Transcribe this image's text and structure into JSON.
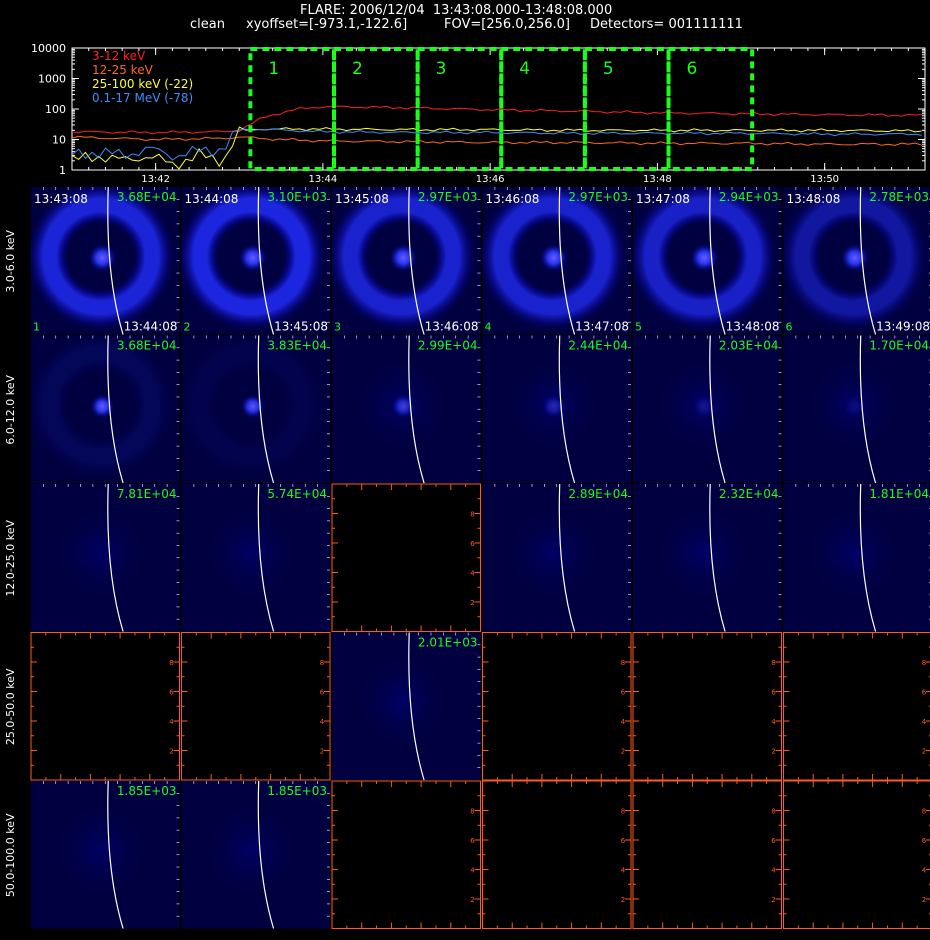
{
  "header": {
    "title": "FLARE: 2006/12/04  13:43:08.000-13:48:08.000",
    "mode": "clean",
    "xyoffset": "xyoffset=[-973.1,-122.6]",
    "fov": "FOV=[256.0,256.0]",
    "detectors": "Detectors= 001111111"
  },
  "colors": {
    "red": "#ff2020",
    "orange": "#ff6a1a",
    "yellow": "#ffff30",
    "blue": "#3f8cff",
    "green": "#19ff19",
    "empty_axis": "#ff5a1e",
    "image_bg": "#000040"
  },
  "chart_data": [
    {
      "type": "line",
      "title": "",
      "y_scale": "log",
      "ylim": [
        1,
        10000
      ],
      "y_ticks": [
        "1",
        "10",
        "100",
        "1000",
        "10000"
      ],
      "x_ticks": [
        "13:42",
        "13:44",
        "13:46",
        "13:48",
        "13:50"
      ],
      "xlim_minutes": [
        41.0,
        51.2
      ],
      "legend_placement": "top-left",
      "series": [
        {
          "name": "3-12 keV",
          "color": "#ff2020",
          "x": [
            41.0,
            42.0,
            42.8,
            43.0,
            43.3,
            43.7,
            44.0,
            45.0,
            46.0,
            47.0,
            48.0,
            49.0,
            50.0,
            51.2
          ],
          "y": [
            18,
            17,
            18,
            20,
            55,
            100,
            120,
            110,
            95,
            85,
            75,
            70,
            65,
            62
          ]
        },
        {
          "name": "12-25 keV",
          "color": "#ff6a1a",
          "x": [
            41.0,
            42.0,
            42.8,
            43.0,
            43.5,
            44.0,
            45.0,
            46.0,
            47.0,
            48.0,
            49.0,
            50.0,
            51.2
          ],
          "y": [
            12,
            10,
            11,
            12,
            10,
            9,
            8.5,
            8,
            8,
            7.5,
            7.5,
            7,
            7
          ]
        },
        {
          "name": "25-100 keV (-22)",
          "color": "#ffff30",
          "x": [
            41.0,
            41.3,
            41.6,
            41.9,
            42.2,
            42.5,
            42.8,
            43.0,
            43.2,
            44.0,
            45.0,
            46.0,
            47.0,
            48.0,
            49.0,
            50.0,
            51.2
          ],
          "y": [
            2,
            3,
            2,
            3,
            1.5,
            3,
            2,
            18,
            22,
            22,
            21,
            21,
            20,
            20,
            20,
            20,
            19
          ]
        },
        {
          "name": "0.1-17 MeV (-78)",
          "color": "#3f8cff",
          "x": [
            41.0,
            41.3,
            41.6,
            41.9,
            42.2,
            42.5,
            42.8,
            43.0,
            43.2,
            44.0,
            45.0,
            46.0,
            47.0,
            48.0,
            49.0,
            50.0,
            51.2
          ],
          "y": [
            3,
            4,
            3,
            5,
            3,
            4,
            5,
            20,
            22,
            18,
            17,
            17,
            16,
            16,
            16,
            15,
            15
          ]
        }
      ],
      "intervals": [
        {
          "label": "1",
          "start": 43.133,
          "end": 44.133
        },
        {
          "label": "2",
          "start": 44.133,
          "end": 45.133
        },
        {
          "label": "3",
          "start": 45.133,
          "end": 46.133
        },
        {
          "label": "4",
          "start": 46.133,
          "end": 47.133
        },
        {
          "label": "5",
          "start": 47.133,
          "end": 48.133
        },
        {
          "label": "6",
          "start": 48.133,
          "end": 49.133
        }
      ]
    },
    {
      "type": "heatmap",
      "columns": [
        {
          "start": "13:43:08",
          "end": "13:44:08",
          "index": "1"
        },
        {
          "start": "13:44:08",
          "end": "13:45:08",
          "index": "2"
        },
        {
          "start": "13:45:08",
          "end": "13:46:08",
          "index": "3"
        },
        {
          "start": "13:46:08",
          "end": "13:47:08",
          "index": "4"
        },
        {
          "start": "13:47:08",
          "end": "13:48:08",
          "index": "5"
        },
        {
          "start": "13:48:08",
          "end": "13:49:08",
          "index": "6"
        }
      ],
      "empty_tick_labels": [
        "2",
        "4",
        "6",
        "8"
      ],
      "rows": [
        {
          "label": "3.0-6.0 keV",
          "show_times": true,
          "peaks": [
            "3.68E+04",
            "3.10E+03",
            "2.97E+03",
            "2.97E+03",
            "2.94E+03",
            "2.78E+03"
          ],
          "ring": [
            0.95,
            1.0,
            0.9,
            0.9,
            0.85,
            0.6
          ]
        },
        {
          "label": "6.0-12.0 keV",
          "show_times": false,
          "peaks": [
            "3.68E+04",
            "3.83E+04",
            "2.99E+04",
            "2.44E+04",
            "2.03E+04",
            "1.70E+04"
          ],
          "ring": [
            0.15,
            0.08,
            0,
            0,
            0,
            0
          ]
        },
        {
          "label": "12.0-25.0 keV",
          "show_times": false,
          "peaks": [
            "7.81E+04",
            "5.74E+04",
            null,
            "2.89E+04",
            "2.32E+04",
            "1.81E+04"
          ],
          "ring": [
            0,
            0,
            0,
            0,
            0,
            0
          ]
        },
        {
          "label": "25.0-50.0 keV",
          "show_times": false,
          "peaks": [
            null,
            null,
            "2.01E+03",
            null,
            null,
            null
          ],
          "ring": [
            0,
            0,
            0,
            0,
            0,
            0
          ]
        },
        {
          "label": "50.0-100.0 keV",
          "show_times": false,
          "peaks": [
            "1.85E+03",
            "1.85E+03",
            null,
            null,
            null,
            null
          ],
          "ring": [
            0,
            0,
            0,
            0,
            0,
            0
          ]
        }
      ]
    }
  ]
}
